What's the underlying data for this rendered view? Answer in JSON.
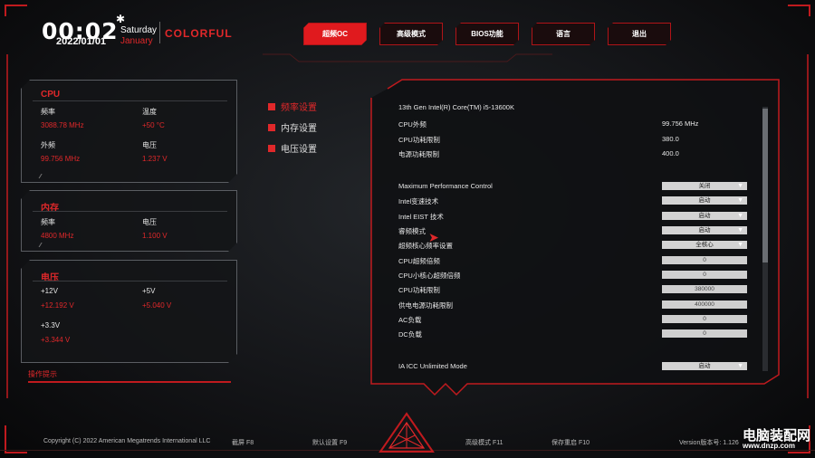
{
  "header": {
    "time": "00:02",
    "date": "2022/01/01",
    "weekday": "Saturday",
    "month": "January",
    "brand": "COLORFUL",
    "tabs": [
      "超频OC",
      "高级模式",
      "BIOS功能",
      "语言",
      "退出"
    ]
  },
  "cpu_panel": {
    "title": "CPU",
    "freq_label": "频率",
    "freq_value": "3088.78 MHz",
    "temp_label": "温度",
    "temp_value": "+50 °C",
    "bclk_label": "外频",
    "bclk_value": "99.756 MHz",
    "volt_label": "电压",
    "volt_value": "1.237 V"
  },
  "mem_panel": {
    "title": "内存",
    "freq_label": "频率",
    "freq_value": "4800 MHz",
    "volt_label": "电压",
    "volt_value": "1.100 V"
  },
  "volt_panel": {
    "title": "电压",
    "v12_label": "+12V",
    "v12_value": "+12.192 V",
    "v5_label": "+5V",
    "v5_value": "+5.040 V",
    "v33_label": "+3.3V",
    "v33_value": "+3.344 V"
  },
  "hint": "操作提示",
  "side_menu": [
    "频率设置",
    "内存设置",
    "电压设置"
  ],
  "main": {
    "cpu_model": "13th Gen Intel(R) Core(TM) i5-13600K",
    "info": [
      {
        "label": "CPU外频",
        "value": "99.756 MHz"
      },
      {
        "label": "CPU功耗限制",
        "value": "380.0"
      },
      {
        "label": "电源功耗限制",
        "value": "400.0"
      }
    ],
    "settings": [
      {
        "label": "Maximum Performance Control",
        "value": "关闭",
        "type": "select"
      },
      {
        "label": "Intel变速技术",
        "value": "启动",
        "type": "select"
      },
      {
        "label": "Intel EIST 技术",
        "value": "启动",
        "type": "select"
      },
      {
        "label": "睿频模式",
        "value": "启动",
        "type": "select"
      },
      {
        "label": "超频核心频率设置",
        "value": "全核心",
        "type": "select"
      },
      {
        "label": "CPU超频倍频",
        "value": "0",
        "type": "input"
      },
      {
        "label": "CPU小核心超频倍频",
        "value": "0",
        "type": "input"
      },
      {
        "label": "CPU功耗限制",
        "value": "380000",
        "type": "input"
      },
      {
        "label": "供电电源功耗限制",
        "value": "400000",
        "type": "input"
      },
      {
        "label": "AC负载",
        "value": "0",
        "type": "input"
      },
      {
        "label": "DC负载",
        "value": "0",
        "type": "input"
      }
    ],
    "icc": {
      "label": "IA ICC Unlimited Mode",
      "value": "启动"
    }
  },
  "footer": {
    "copyright": "Copyright (C) 2022 American Megatrends International LLC",
    "screenshot": "截屏 F8",
    "defaults": "默认设置 F9",
    "advanced": "高级模式 F11",
    "save": "保存重启 F10",
    "version": "Version版本号: 1.126"
  },
  "watermark": {
    "title": "电脑装配网",
    "url": "www.dnzp.com"
  },
  "colors": {
    "accent": "#e0282a",
    "panel_border": "#5a5d62"
  }
}
